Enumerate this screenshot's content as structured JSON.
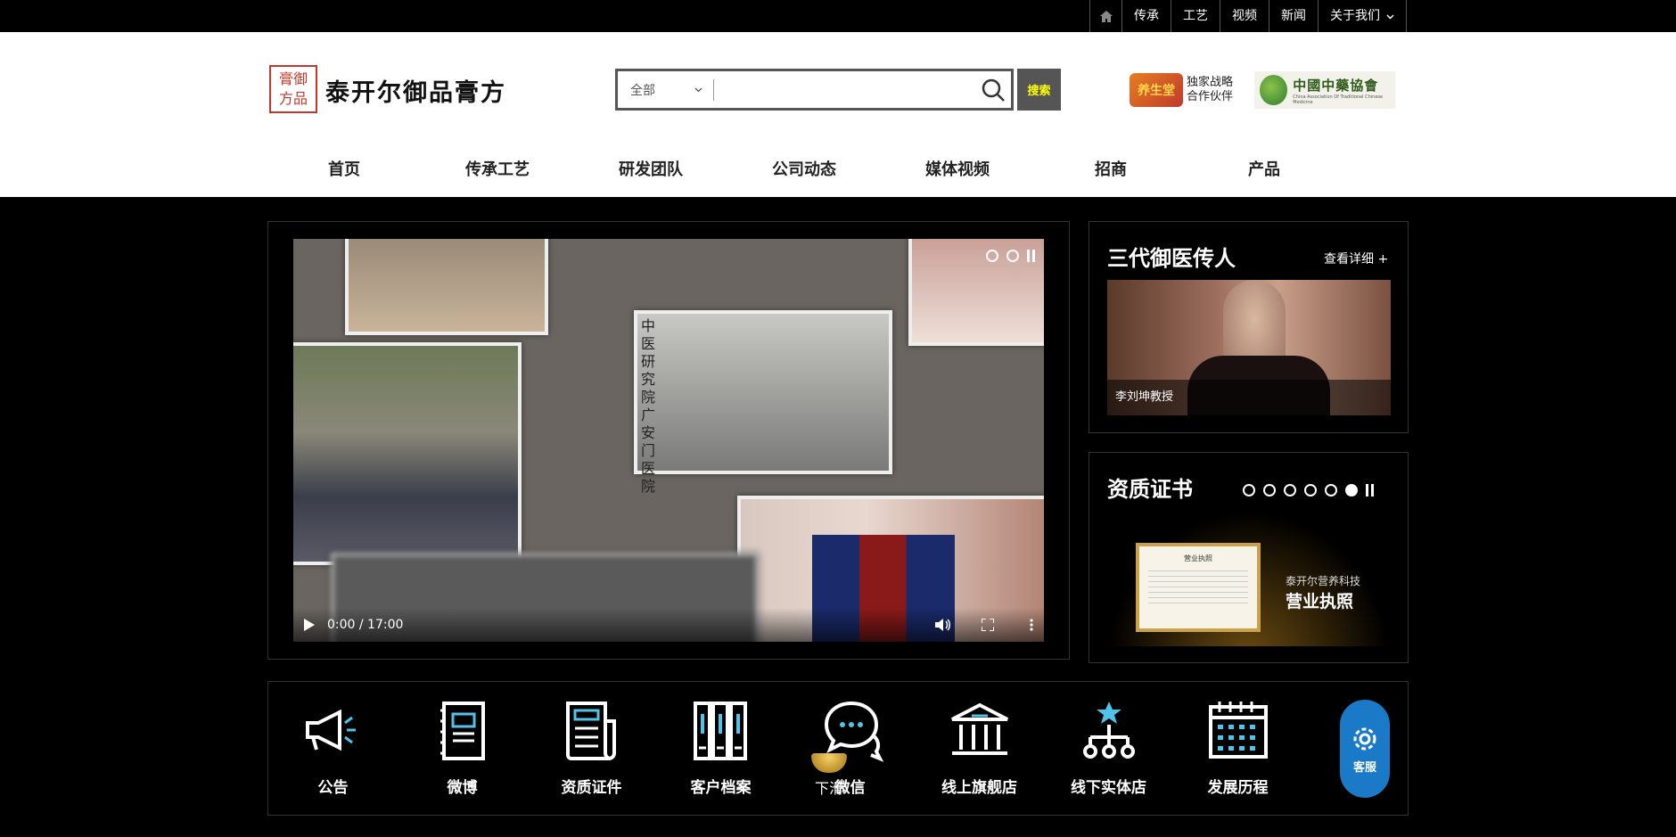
{
  "topbar": {
    "links": [
      "传承",
      "工艺",
      "视频",
      "新闻",
      "关于我们"
    ],
    "home_icon": "home-icon",
    "dropdown_icon": "chevron-down-icon"
  },
  "header": {
    "logo_text": "膏御方品",
    "brand_name": "泰开尔御品膏方",
    "search": {
      "category": "全部",
      "placeholder": "",
      "button_label": "搜索"
    },
    "partner": {
      "seal_text": "养生堂",
      "line1": "独家战略",
      "line2": "合作伙伴"
    },
    "association": {
      "name": "中國中藥協會",
      "english": "China Association Of Traditional Chinese Medicine"
    }
  },
  "nav": [
    "首页",
    "传承工艺",
    "研发团队",
    "公司动态",
    "媒体视频",
    "招商",
    "产品"
  ],
  "video": {
    "time": "0:00 / 17:00",
    "slides": 2,
    "active_slide": 0,
    "photo_sign": "中医研究院广安门医院"
  },
  "heritage": {
    "title": "三代御医传人",
    "more": "查看详细 +",
    "caption": "李刘坤教授"
  },
  "certs": {
    "title": "资质证书",
    "slides": 6,
    "active_slide": 5,
    "card_small": "泰开尔营养科技",
    "card_big": "营业执照",
    "frame_title": "营业执照"
  },
  "icons": [
    {
      "label": "公告",
      "icon": "megaphone-icon"
    },
    {
      "label": "微博",
      "icon": "notebook-icon"
    },
    {
      "label": "资质证件",
      "icon": "newspaper-icon"
    },
    {
      "label": "客户档案",
      "icon": "binders-icon"
    },
    {
      "label": "微信",
      "icon": "chat-bubbles-icon"
    },
    {
      "label": "线上旗舰店",
      "icon": "bank-building-icon"
    },
    {
      "label": "线下实体店",
      "icon": "store-network-icon"
    },
    {
      "label": "发展历程",
      "icon": "calendar-icon"
    }
  ],
  "service": {
    "label": "客服",
    "icon": "gear-icon"
  },
  "scroll_hint": "下滑",
  "colors": {
    "accent": "#4fc3e8",
    "service_blue": "#1a7ac7",
    "search_btn_text": "#ffff00"
  }
}
